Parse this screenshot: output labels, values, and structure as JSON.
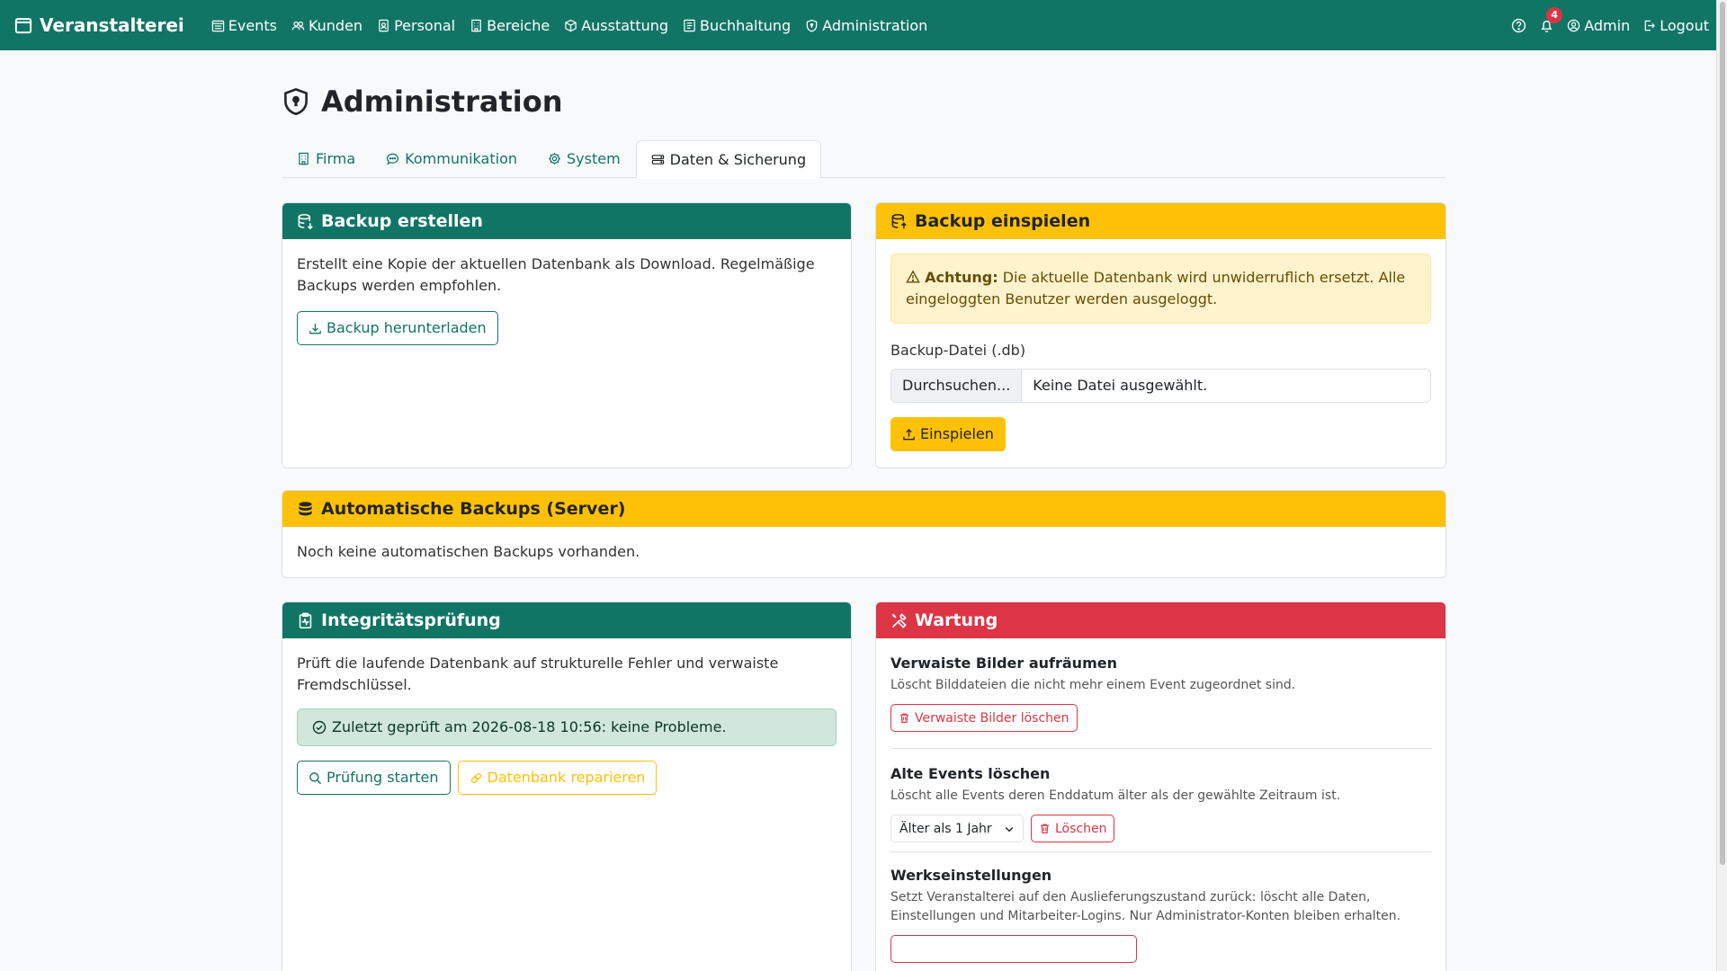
{
  "nav": {
    "brand": "Veranstalterei",
    "links": [
      {
        "label": "Events",
        "icon": "calendar-week-icon"
      },
      {
        "label": "Kunden",
        "icon": "people-icon"
      },
      {
        "label": "Personal",
        "icon": "badge-icon"
      },
      {
        "label": "Bereiche",
        "icon": "building-icon"
      },
      {
        "label": "Ausstattung",
        "icon": "box-icon"
      },
      {
        "label": "Buchhaltung",
        "icon": "ledger-icon"
      },
      {
        "label": "Administration",
        "icon": "shield-icon"
      }
    ],
    "notification_count": "4",
    "user": "Admin",
    "logout": "Logout"
  },
  "page": {
    "title": "Administration",
    "tabs": [
      {
        "label": "Firma",
        "icon": "building-icon"
      },
      {
        "label": "Kommunikation",
        "icon": "chat-icon"
      },
      {
        "label": "System",
        "icon": "gear-icon"
      },
      {
        "label": "Daten & Sicherung",
        "icon": "hdd-icon",
        "active": true
      }
    ]
  },
  "backup_create": {
    "title": "Backup erstellen",
    "text": "Erstellt eine Kopie der aktuellen Datenbank als Download. Regelmäßige Backups werden empfohlen.",
    "button": "Backup herunterladen"
  },
  "backup_restore": {
    "title": "Backup einspielen",
    "warning_strong": "Achtung:",
    "warning_text": " Die aktuelle Datenbank wird unwiderruflich ersetzt. Alle eingeloggten Benutzer werden ausgeloggt.",
    "file_label": "Backup-Datei (.db)",
    "file_button": "Durchsuchen...",
    "file_status": "Keine Datei ausgewählt.",
    "button": "Einspielen"
  },
  "auto_backups": {
    "title": "Automatische Backups (Server)",
    "text": "Noch keine automatischen Backups vorhanden."
  },
  "integrity": {
    "title": "Integritätsprüfung",
    "text": "Prüft die laufende Datenbank auf strukturelle Fehler und verwaiste Fremdschlüssel.",
    "status": "Zuletzt geprüft am 2026-08-18 10:56: keine Probleme.",
    "check_button": "Prüfung starten",
    "repair_button": "Datenbank reparieren"
  },
  "maintenance": {
    "title": "Wartung",
    "orphans_title": "Verwaiste Bilder aufräumen",
    "orphans_desc": "Löscht Bilddateien die nicht mehr einem Event zugeordnet sind.",
    "orphans_button": "Verwaiste Bilder löschen",
    "old_events_title": "Alte Events löschen",
    "old_events_desc": "Löscht alle Events deren Enddatum älter als der gewählte Zeitraum ist.",
    "old_events_select": "Älter als 1 Jahr",
    "old_events_button": "Löschen",
    "factory_title": "Werkseinstellungen",
    "factory_desc": "Setzt Veranstalterei auf den Auslieferungszustand zurück: löscht alle Daten, Einstellungen und Mitarbeiter-Logins. Nur Administrator-Konten bleiben erhalten."
  },
  "colors": {
    "primary": "#117566",
    "warning": "#ffc107",
    "danger": "#dc3545",
    "success_bg": "#d1e7dd"
  }
}
